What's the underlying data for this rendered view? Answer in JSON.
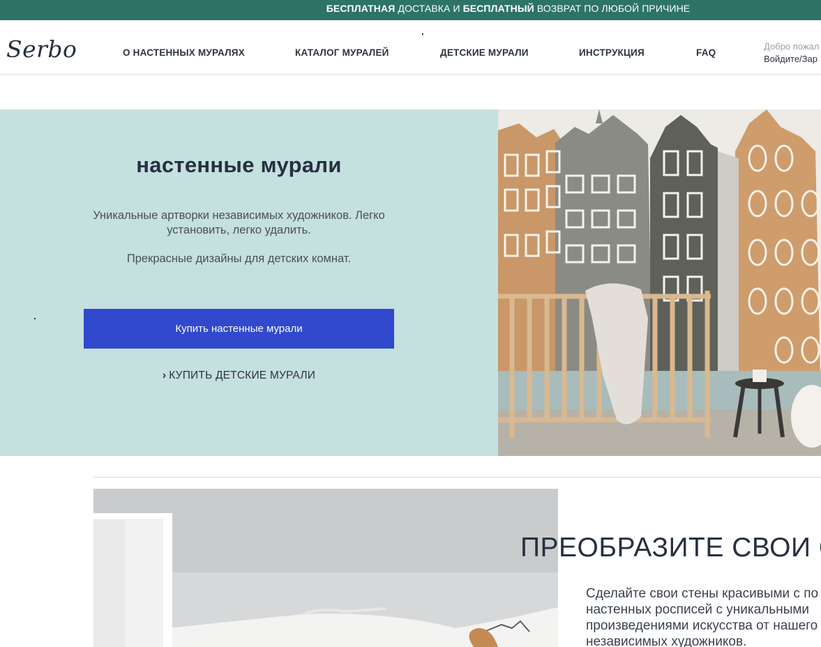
{
  "promo": {
    "free1": "БЕСПЛАТНАЯ",
    "text1": " ДОСТАВКА И ",
    "free2": "БЕСПЛАТНЫЙ",
    "text2": " ВОЗВРАТ ПО ЛЮБОЙ ПРИЧИНЕ"
  },
  "header": {
    "logo": "Serbo",
    "nav": [
      "О НАСТЕННЫХ МУРАЛЯХ",
      "КАТАЛОГ МУРАЛЕЙ",
      "ДЕТСКИЕ МУРАЛИ",
      "ИНСТРУКЦИЯ",
      "FAQ"
    ],
    "greeting": "Добро пожал",
    "login": "Войдите/Зар"
  },
  "hero": {
    "title": "настенные мурали",
    "description": "Уникальные артворки независимых художников. Легко установить, легко удалить.",
    "subtitle": "Прекрасные дизайны для детских комнат.",
    "button": "Купить настенные мурали",
    "link": "КУПИТЬ ДЕТСКИЕ МУРАЛИ"
  },
  "section2": {
    "title": "ПРЕОБРАЗИТЕ СВОИ С",
    "text": "Сделайте свои стены красивыми с по настенных росписей с уникальными произведениями искусства от нашего независимых художников."
  },
  "colors": {
    "promo_bg": "#2d7368",
    "hero_bg": "#c4e0df",
    "button_bg": "#3149cc",
    "text_dark": "#263040"
  }
}
